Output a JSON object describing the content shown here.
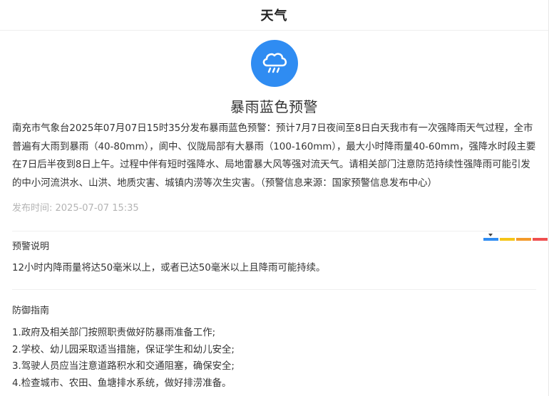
{
  "header": {
    "title": "天气"
  },
  "warning": {
    "icon": "cloud-rain-icon",
    "icon_color": "#2f8cf2",
    "title": "暴雨蓝色预警",
    "body": "南充市气象台2025年07月07日15时35分发布暴雨蓝色预警：预计7月7日夜间至8日白天我市有一次强降雨天气过程，全市普遍有大雨到暴雨（40-80mm），阆中、仪陇局部有大暴雨（100-160mm），最大小时降雨量40-60mm，强降水时段主要在7日后半夜到8日上午。过程中伴有短时强降水、局地雷暴大风等强对流天气。请相关部门注意防范持续性强降雨可能引发的中小河流洪水、山洪、地质灾害、城镇内涝等次生灾害。（预警信息来源：国家预警信息发布中心）",
    "publish_time": "发布时间: 2025-07-07 15:35"
  },
  "explanation": {
    "heading": "预警说明",
    "text": "12小时内降雨量将达50毫米以上，或者已达50毫米以上且降雨可能持续。",
    "level_colors": [
      "#2f8cf2",
      "#f5c518",
      "#f39a2b",
      "#ef4f4f"
    ],
    "current_level": "blue"
  },
  "guide": {
    "heading": "防御指南",
    "items": [
      "1.政府及相关部门按照职责做好防暴雨准备工作;",
      "2.学校、幼儿园采取适当措施，保证学生和幼儿安全;",
      "3.驾驶人员应当注意道路积水和交通阻塞，确保安全;",
      "4.检查城市、农田、鱼塘排水系统，做好排涝准备。"
    ]
  }
}
